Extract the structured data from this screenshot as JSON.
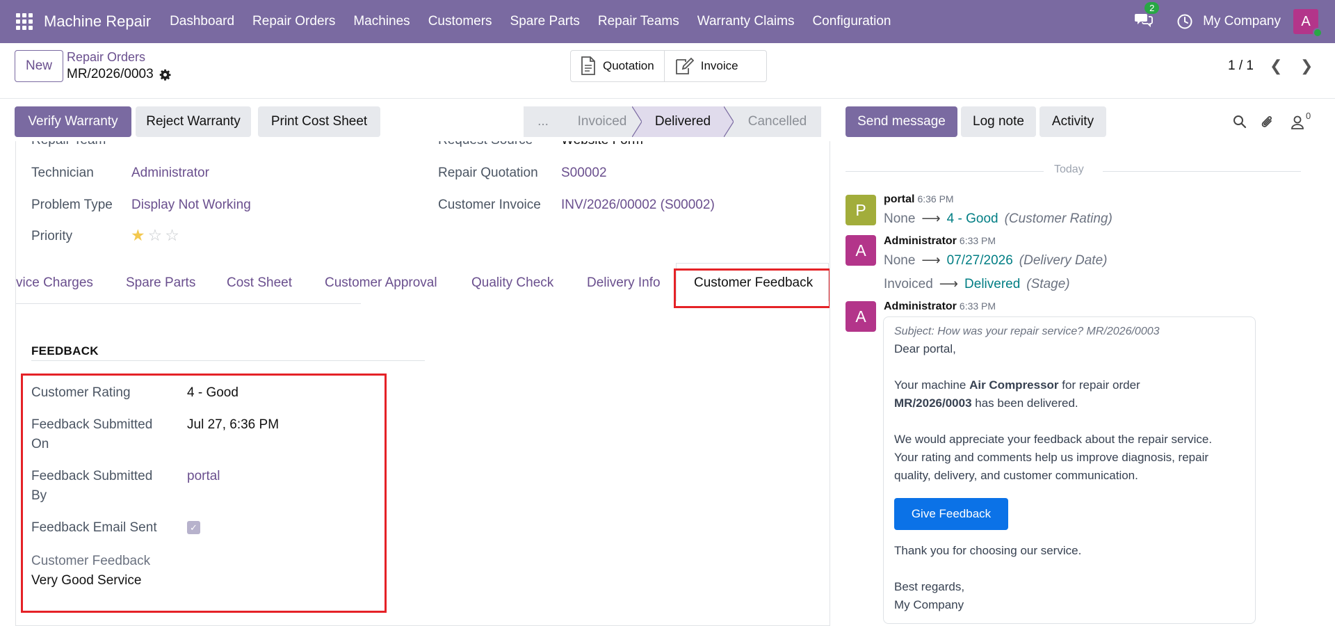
{
  "navbar": {
    "app_name": "Machine Repair",
    "menu": [
      "Dashboard",
      "Repair Orders",
      "Machines",
      "Customers",
      "Spare Parts",
      "Repair Teams",
      "Warranty Claims",
      "Configuration"
    ],
    "message_count": "2",
    "company": "My Company",
    "avatar_letter": "A"
  },
  "control_panel": {
    "new_label": "New",
    "breadcrumb_parent": "Repair Orders",
    "record_name": "MR/2026/0003",
    "smart_buttons": [
      "Quotation",
      "Invoice"
    ],
    "pager": "1 / 1"
  },
  "actions": {
    "verify": "Verify Warranty",
    "reject": "Reject Warranty",
    "print": "Print Cost Sheet"
  },
  "statusbar": {
    "stages": [
      "...",
      "Invoiced",
      "Delivered",
      "Cancelled"
    ],
    "active": "Delivered"
  },
  "chatter_actions": {
    "send": "Send message",
    "log": "Log note",
    "activity": "Activity",
    "followers": "0"
  },
  "form": {
    "cut_labels": {
      "left": "Repair Team",
      "right": "Request Source",
      "right_value": "Website Form"
    },
    "technician_label": "Technician",
    "technician": "Administrator",
    "problem_type_label": "Problem Type",
    "problem_type": "Display Not Working",
    "priority_label": "Priority",
    "priority_stars": 1,
    "repair_quotation_label": "Repair Quotation",
    "repair_quotation": "S00002",
    "customer_invoice_label": "Customer Invoice",
    "customer_invoice": "INV/2026/00002 (S00002)"
  },
  "tabs": [
    "vice Charges",
    "Spare Parts",
    "Cost Sheet",
    "Customer Approval",
    "Quality Check",
    "Delivery Info",
    "Customer Feedback"
  ],
  "feedback": {
    "section_title": "FEEDBACK",
    "rating_label": "Customer Rating",
    "rating": "4 - Good",
    "submitted_on_label_1": "Feedback Submitted",
    "submitted_on_label_2": "On",
    "submitted_on": "Jul 27, 6:36 PM",
    "submitted_by_label_1": "Feedback Submitted",
    "submitted_by_label_2": "By",
    "submitted_by": "portal",
    "email_sent_label": "Feedback Email Sent",
    "email_sent": true,
    "comment_label": "Customer Feedback",
    "comment": "Very Good Service"
  },
  "chatter": {
    "today": "Today",
    "messages": [
      {
        "avatar": "P",
        "avatar_color": "#a2ad3b",
        "author": "portal",
        "time": "6:36 PM",
        "tracks": [
          {
            "old": "None",
            "new": "4 - Good",
            "field": "(Customer Rating)"
          }
        ]
      },
      {
        "avatar": "A",
        "avatar_color": "#b3358a",
        "author": "Administrator",
        "time": "6:33 PM",
        "tracks": [
          {
            "old": "None",
            "new": "07/27/2026",
            "field": "(Delivery Date)"
          },
          {
            "old": "Invoiced",
            "new": "Delivered",
            "field": "(Stage)"
          }
        ]
      },
      {
        "avatar": "A",
        "avatar_color": "#b3358a",
        "author": "Administrator",
        "time": "6:33 PM"
      }
    ],
    "mail": {
      "subject": "Subject: How was your repair service? MR/2026/0003",
      "greeting": "Dear portal,",
      "p1_a": "Your machine ",
      "p1_machine": "Air Compressor",
      "p1_b": " for repair order",
      "p1_order": "MR/2026/0003",
      "p1_c": " has been delivered.",
      "p2_1": "We would appreciate your feedback about the repair service.",
      "p2_2": "Your rating and comments help us improve diagnosis, repair",
      "p2_3": "quality, delivery, and customer communication.",
      "button": "Give Feedback",
      "thanks": "Thank you for choosing our service.",
      "regards": "Best regards,",
      "signature": "My Company"
    }
  },
  "colors": {
    "brand": "#7a6aa1",
    "highlight": "#e52227",
    "tracking": "#017e84"
  }
}
